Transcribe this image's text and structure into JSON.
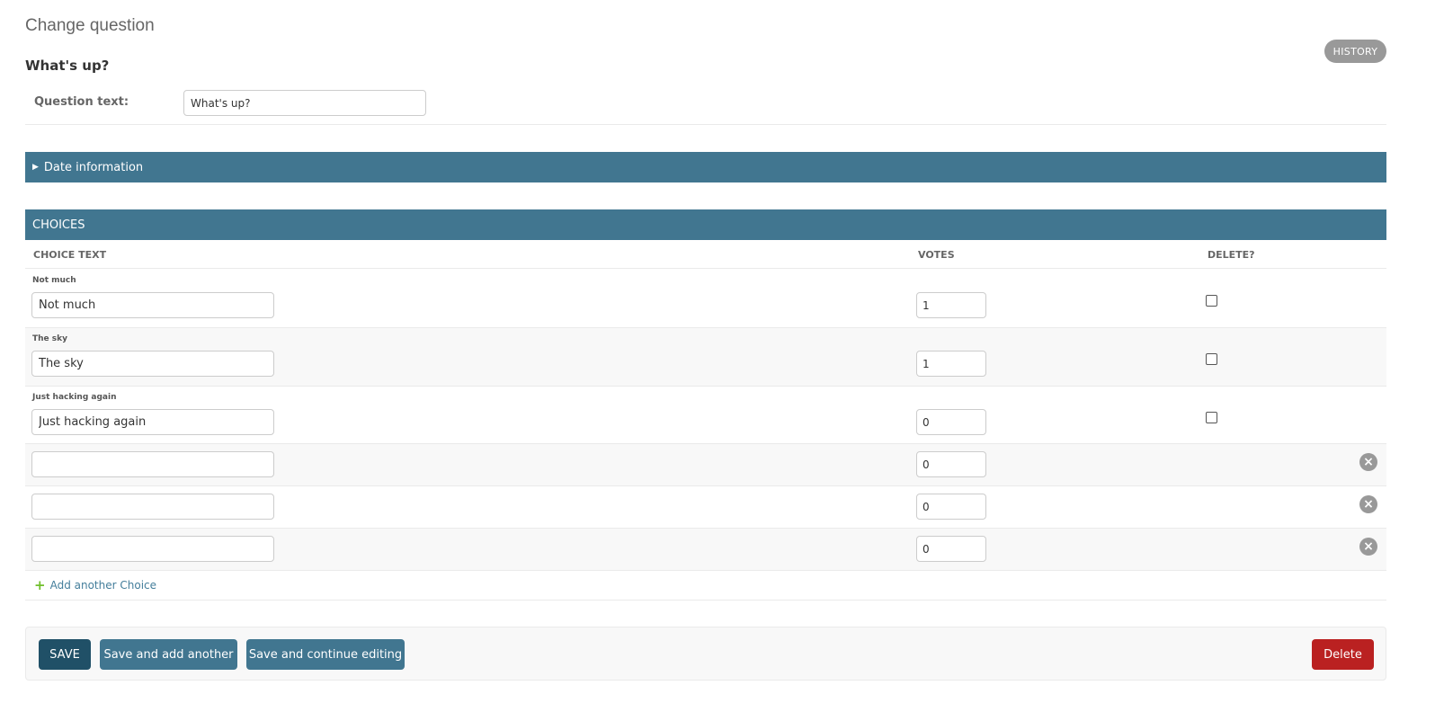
{
  "header": {
    "page_title": "Change question",
    "object_title": "What's up?",
    "history_label": "HISTORY"
  },
  "question": {
    "label": "Question text:",
    "value": "What's up?"
  },
  "date_section": {
    "toggle_icon": "triangle-right-icon",
    "label": "Date information"
  },
  "choices": {
    "title": "CHOICES",
    "columns": {
      "choice_text": "CHOICE TEXT",
      "votes": "VOTES",
      "delete": "DELETE?"
    },
    "rows": [
      {
        "original": "Not much",
        "text": "Not much",
        "votes": "1",
        "delete": false
      },
      {
        "original": "The sky",
        "text": "The sky",
        "votes": "1",
        "delete": false
      },
      {
        "original": "Just hacking again",
        "text": "Just hacking again",
        "votes": "0",
        "delete": false
      },
      {
        "original": "",
        "text": "",
        "votes": "0"
      },
      {
        "original": "",
        "text": "",
        "votes": "0"
      },
      {
        "original": "",
        "text": "",
        "votes": "0"
      }
    ],
    "add_label": "Add another Choice"
  },
  "submit": {
    "save": "SAVE",
    "save_add_another": "Save and add another",
    "save_continue": "Save and continue editing",
    "delete": "Delete"
  },
  "colors": {
    "module_header": "#417690",
    "save_button": "#205067",
    "delete_button": "#ba2121",
    "add_icon": "#70bf2b"
  }
}
